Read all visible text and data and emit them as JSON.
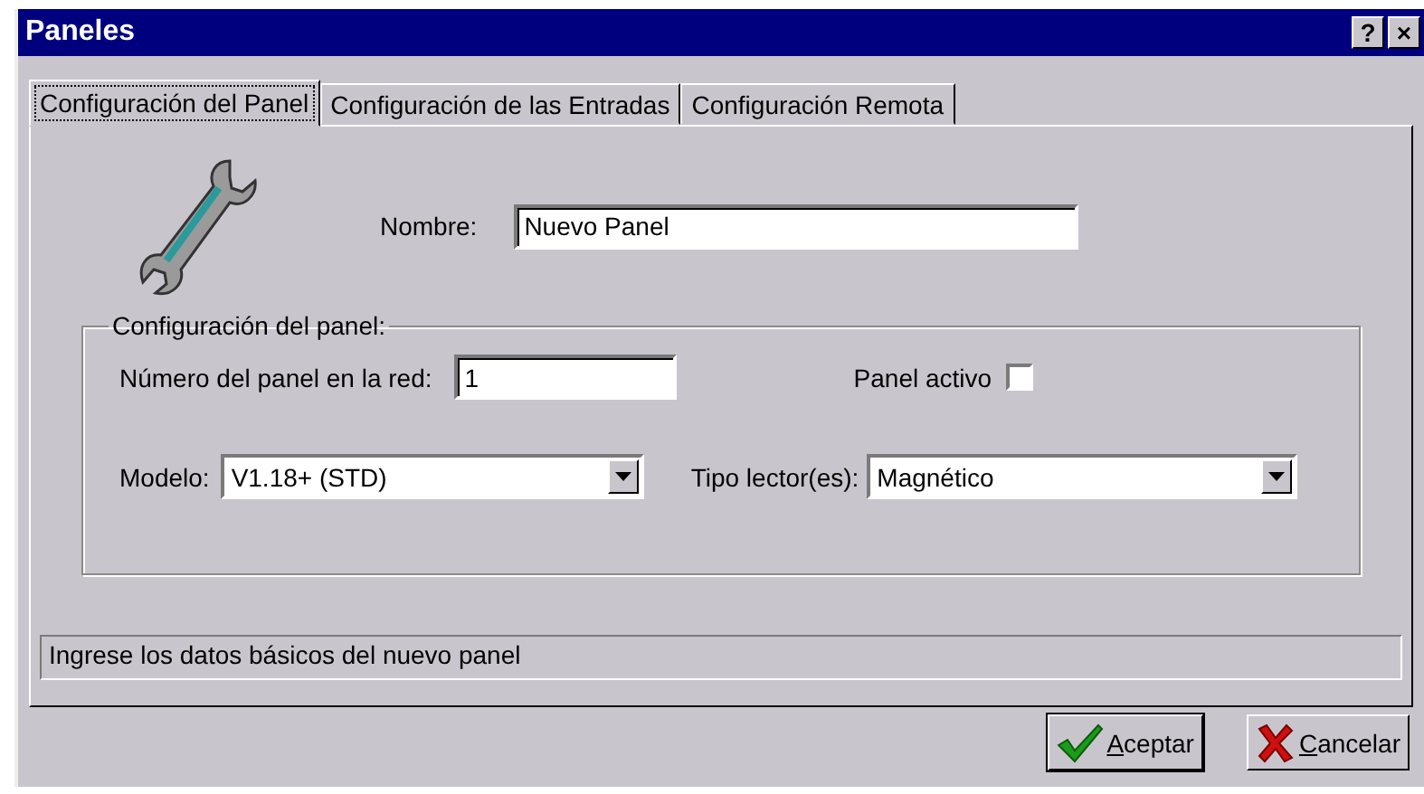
{
  "window": {
    "title": "Paneles",
    "help_button": "?",
    "close_button": "×"
  },
  "tabs": [
    {
      "label": "Configuración del Panel",
      "selected": true
    },
    {
      "label": "Configuración de las Entradas",
      "selected": false
    },
    {
      "label": "Configuración Remota",
      "selected": false
    }
  ],
  "name_field": {
    "label": "Nombre:",
    "value": "Nuevo Panel"
  },
  "group": {
    "title": "Configuración del panel:",
    "number_field": {
      "label": "Número del panel en la red:",
      "value": "1"
    },
    "active": {
      "label": "Panel activo",
      "checked": false
    },
    "model": {
      "label": "Modelo:",
      "value": "V1.18+ (STD)"
    },
    "reader": {
      "label": "Tipo lector(es):",
      "value": "Magnético"
    }
  },
  "status_bar": "Ingrese los datos básicos del nuevo panel",
  "buttons": [
    {
      "kind": "ok",
      "label": "Aceptar"
    },
    {
      "kind": "cancel",
      "label": "Cancelar"
    }
  ]
}
